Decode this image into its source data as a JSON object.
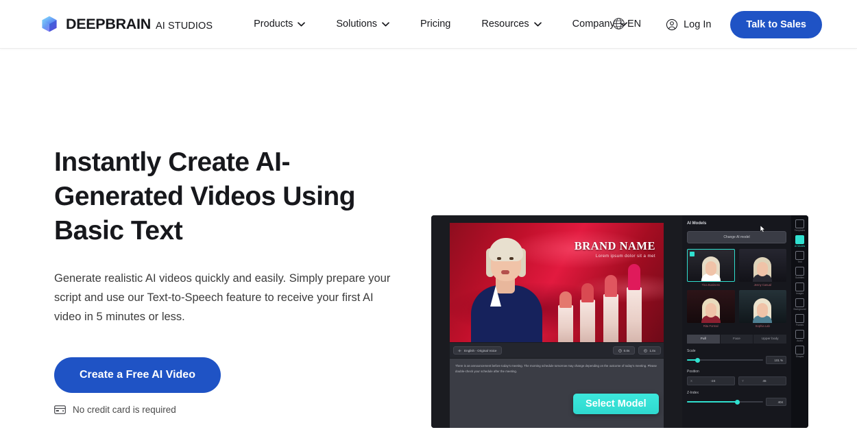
{
  "header": {
    "brand": {
      "name": "DEEPBRAIN",
      "sub": "AI STUDIOS",
      "logo_icon": "cube-logo-icon"
    },
    "nav": [
      {
        "label": "Products",
        "has_dropdown": true
      },
      {
        "label": "Solutions",
        "has_dropdown": true
      },
      {
        "label": "Pricing",
        "has_dropdown": false
      },
      {
        "label": "Resources",
        "has_dropdown": true
      },
      {
        "label": "Company",
        "has_dropdown": true
      }
    ],
    "language": {
      "label": "EN",
      "icon": "globe-icon"
    },
    "login": {
      "label": "Log In",
      "icon": "user-circle-icon"
    },
    "cta": {
      "label": "Talk to Sales"
    },
    "accent_color": "#1f53c5"
  },
  "hero": {
    "title": "Instantly Create AI-Generated Videos Using Basic Text",
    "subtitle": "Generate realistic AI videos quickly and easily. Simply prepare your script and use our Text-to-Speech feature to receive your first AI video in 5 minutes or less.",
    "cta_label": "Create a Free AI Video",
    "note": "No credit card is required",
    "note_icon": "credit-card-icon"
  },
  "editor": {
    "preview": {
      "brand_name": "BRAND NAME",
      "brand_tagline": "Lorem ipsum dolor sit a met"
    },
    "toolbar": {
      "voice_chip": "English - Original Voice",
      "voice_icon": "voice-wave-icon",
      "duration": "0.0s",
      "duration_icon": "clock-icon",
      "speed": "1.0x",
      "speed_icon": "speed-icon"
    },
    "script": "There is an announcement before today's meeting. The morning schedule tomorrow may change depending on the outcome of today's meeting. Please double-check your schedule after the meeting.",
    "select_model_label": "Select Model",
    "panel": {
      "title": "AI Models",
      "change_model_label": "Change AI model",
      "models": [
        {
          "label": "Tina Business",
          "selected": true
        },
        {
          "label": "Jenny Casual",
          "selected": false
        },
        {
          "label": "Rita Formal",
          "selected": false
        },
        {
          "label": "Sophia Lab",
          "selected": false
        }
      ],
      "view_tabs": [
        {
          "label": "Full",
          "active": true
        },
        {
          "label": "Face",
          "active": false
        },
        {
          "label": "Upper body",
          "active": false
        }
      ],
      "controls": [
        {
          "label": "Scale",
          "value": "101 %",
          "fill_pct": 13
        },
        {
          "label": "Position",
          "x": "-24",
          "y": "45"
        },
        {
          "label": "Z-Index",
          "value": "404",
          "fill_pct": 66
        }
      ]
    },
    "rail": [
      {
        "label": "Templates",
        "active": false,
        "icon": "templates-icon"
      },
      {
        "label": "AI Models",
        "active": true,
        "icon": "ai-model-icon"
      },
      {
        "label": "Text",
        "active": false,
        "icon": "text-icon"
      },
      {
        "label": "Subtitles",
        "active": false,
        "icon": "subtitles-icon"
      },
      {
        "label": "Images",
        "active": false,
        "icon": "image-icon"
      },
      {
        "label": "Background",
        "active": false,
        "icon": "background-icon"
      },
      {
        "label": "Frames",
        "active": false,
        "icon": "frames-icon"
      },
      {
        "label": "Audio",
        "active": false,
        "icon": "audio-icon"
      },
      {
        "label": "Shapes",
        "active": false,
        "icon": "shapes-icon"
      }
    ],
    "accent_color": "#30e0cf"
  }
}
